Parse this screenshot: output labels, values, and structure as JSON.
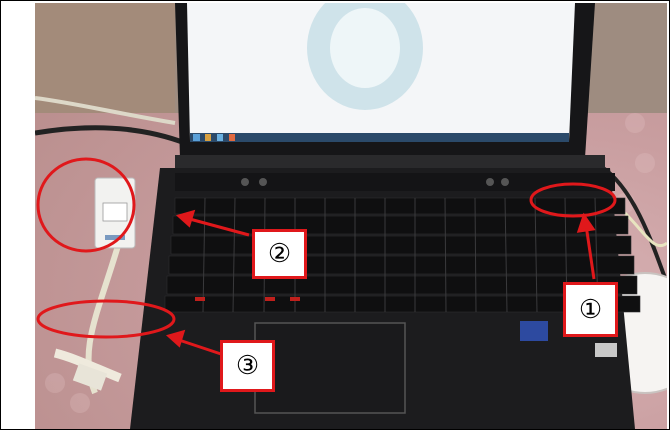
{
  "figure": {
    "markers": [
      {
        "id": "1",
        "label": "①"
      },
      {
        "id": "2",
        "label": "②"
      },
      {
        "id": "3",
        "label": "③"
      }
    ],
    "colors": {
      "annotation": "#e0181b",
      "laptop_body": "#1c1c1e",
      "screen": "#f4f6f8",
      "background_wrap": "#caa0a2",
      "adapter": "#f2f2f0"
    },
    "icons": [
      "laptop-photo",
      "usb-adapter",
      "highlight-ellipse",
      "pointer-arrow"
    ]
  }
}
